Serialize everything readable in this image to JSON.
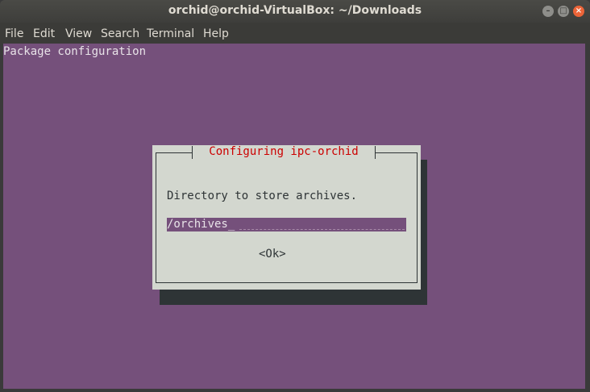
{
  "window": {
    "title": "orchid@orchid-VirtualBox: ~/Downloads",
    "controls": {
      "minimize": "–",
      "maximize": "□",
      "close": "×"
    }
  },
  "menubar": {
    "items": [
      {
        "label": "File"
      },
      {
        "label": "Edit"
      },
      {
        "label": "View"
      },
      {
        "label": "Search"
      },
      {
        "label": "Terminal"
      },
      {
        "label": "Help"
      }
    ]
  },
  "terminal": {
    "header_line": "Package configuration"
  },
  "dialog": {
    "title": "Configuring ipc-orchid",
    "prompt": "Directory to store archives.",
    "input_value": "/orchives_",
    "ok_label": "<Ok>"
  },
  "colors": {
    "terminal_bg": "#75507b",
    "dialog_bg": "#d3d7cf",
    "dialog_title": "#cc0000",
    "close_button": "#ec6438"
  }
}
